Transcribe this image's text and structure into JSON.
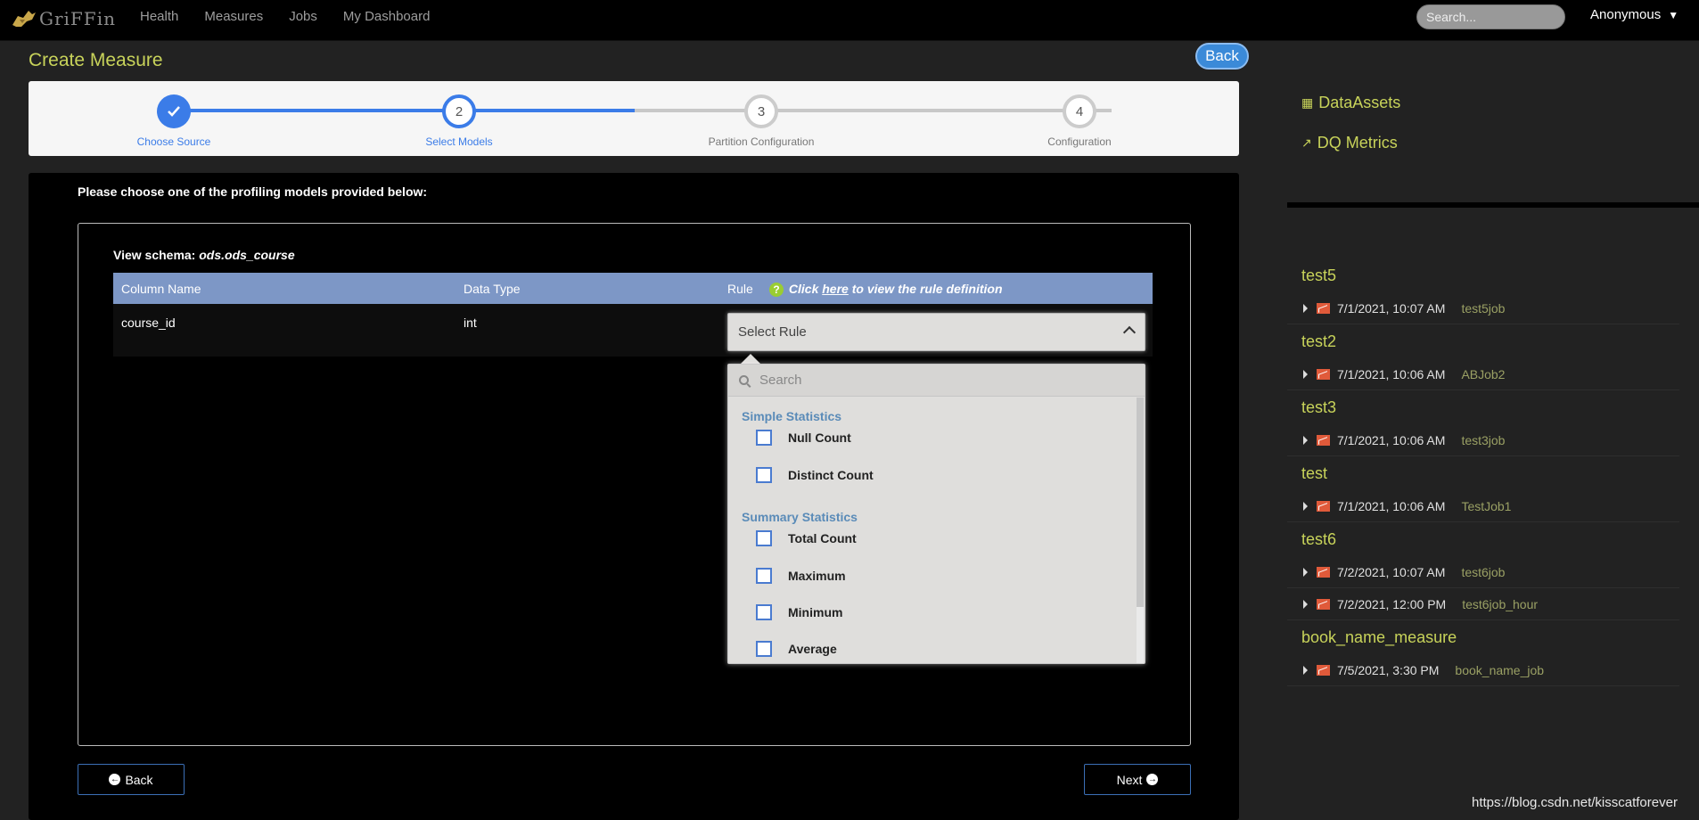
{
  "navbar": {
    "brand": "GriFFin",
    "links": [
      "Health",
      "Measures",
      "Jobs",
      "My Dashboard"
    ],
    "search_placeholder": "Search...",
    "user": "Anonymous"
  },
  "page": {
    "title": "Create Measure",
    "back_label": "Back"
  },
  "stepper": {
    "steps": [
      {
        "number": "",
        "label": "Choose Source",
        "state": "done"
      },
      {
        "number": "2",
        "label": "Select Models",
        "state": "active"
      },
      {
        "number": "3",
        "label": "Partition Configuration",
        "state": "todo"
      },
      {
        "number": "4",
        "label": "Configuration",
        "state": "todo"
      }
    ]
  },
  "main": {
    "instruction": "Please choose one of the profiling models provided below:",
    "schema_label": "View schema:",
    "schema_name": "ods.ods_course",
    "table": {
      "headers": [
        "Column Name",
        "Data Type",
        "Rule"
      ],
      "hint_prefix": "Click",
      "hint_link": "here",
      "hint_suffix": "to view the rule definition",
      "rows": [
        {
          "column": "course_id",
          "type": "int",
          "rule": "Select Rule"
        }
      ]
    },
    "dropdown": {
      "search_placeholder": "Search",
      "groups": [
        {
          "name": "Simple Statistics",
          "options": [
            "Null Count",
            "Distinct Count"
          ]
        },
        {
          "name": "Summary Statistics",
          "options": [
            "Total Count",
            "Maximum",
            "Minimum",
            "Average"
          ]
        }
      ]
    },
    "back_button": "Back",
    "next_button": "Next"
  },
  "sidebar": {
    "links": [
      "DataAssets",
      "DQ Metrics"
    ],
    "measures": [
      {
        "name": "test5",
        "jobs": [
          {
            "time": "7/1/2021, 10:07 AM",
            "job": "test5job"
          }
        ]
      },
      {
        "name": "test2",
        "jobs": [
          {
            "time": "7/1/2021, 10:06 AM",
            "job": "ABJob2"
          }
        ]
      },
      {
        "name": "test3",
        "jobs": [
          {
            "time": "7/1/2021, 10:06 AM",
            "job": "test3job"
          }
        ]
      },
      {
        "name": "test",
        "jobs": [
          {
            "time": "7/1/2021, 10:06 AM",
            "job": "TestJob1"
          }
        ]
      },
      {
        "name": "test6",
        "jobs": [
          {
            "time": "7/2/2021, 10:07 AM",
            "job": "test6job"
          },
          {
            "time": "7/2/2021, 12:00 PM",
            "job": "test6job_hour"
          }
        ]
      },
      {
        "name": "book_name_measure",
        "jobs": [
          {
            "time": "7/5/2021, 3:30 PM",
            "job": "book_name_job"
          }
        ]
      }
    ]
  },
  "watermark": "https://blog.csdn.net/kisscatforever",
  "colors": {
    "accent": "#c8d35a",
    "primary": "#3b7ce8",
    "table_header": "#7d97c6"
  }
}
